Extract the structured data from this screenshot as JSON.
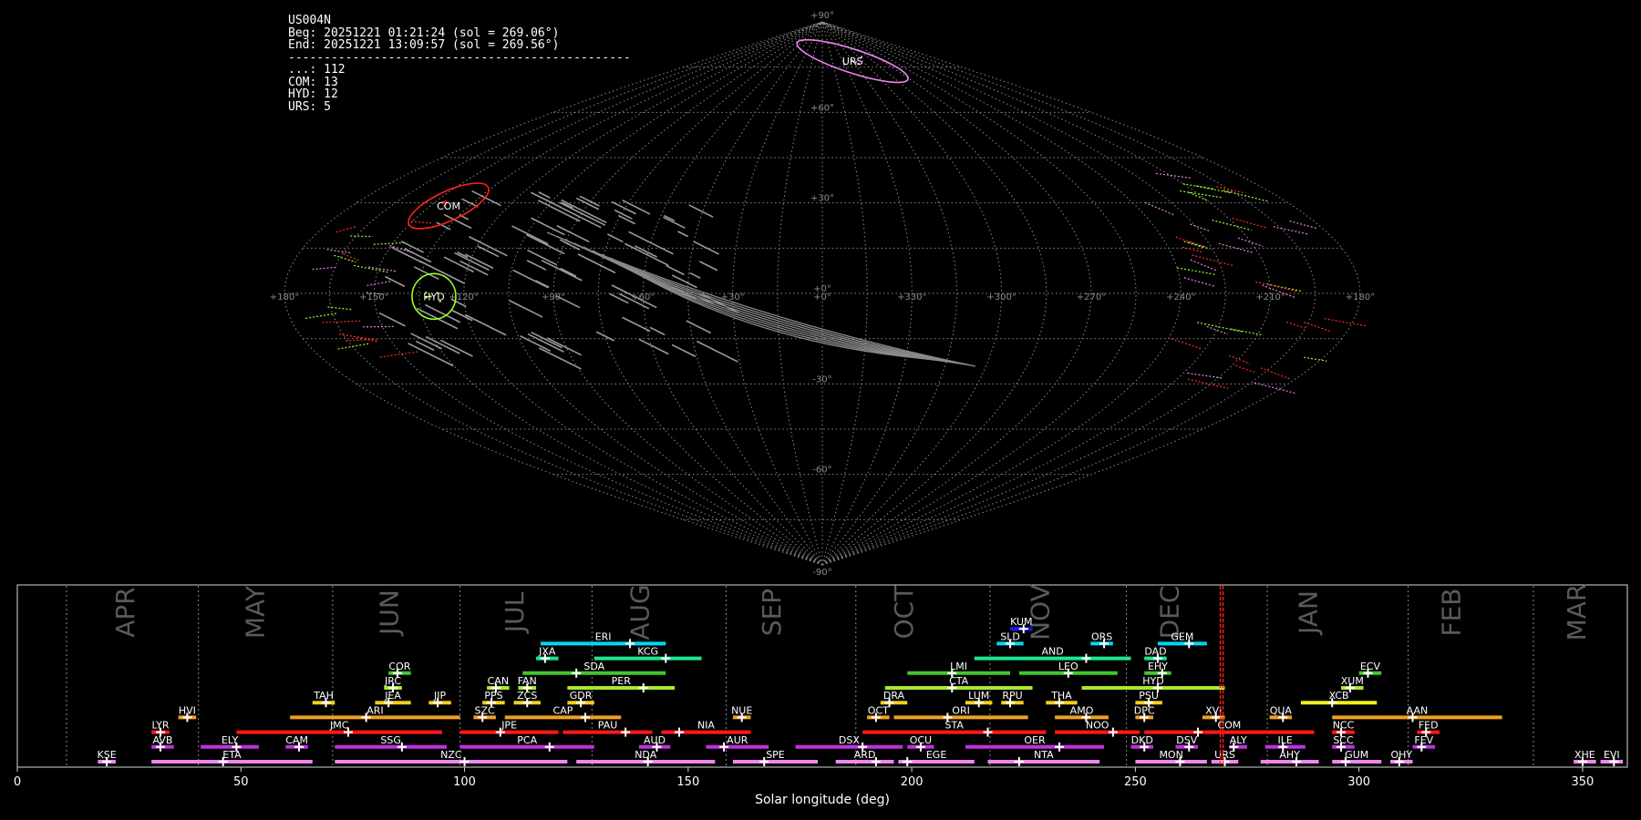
{
  "info": {
    "lines": [
      "US004N",
      "Beg: 20251221 01:21:24 (sol = 269.06°)",
      "End: 20251221 13:09:57 (sol = 269.56°)",
      "------------------------------------------------",
      "...: 112",
      "COM: 13",
      "HYD: 12",
      "URS: 5"
    ]
  },
  "sky_map": {
    "projection": "sinusoidal",
    "lat_ticks": [
      "+90°",
      "+60°",
      "+30°",
      "+0°",
      "-30°",
      "-60°",
      "-90°"
    ],
    "lon_ticks": [
      "+180°",
      "+150°",
      "+120°",
      "+90°",
      "+60°",
      "+30°",
      "+0°",
      "+330°",
      "+300°",
      "+270°",
      "+240°",
      "+210°",
      "+180°"
    ],
    "lon_tick_pos": [
      180,
      150,
      120,
      90,
      60,
      30,
      0,
      -30,
      -60,
      -90,
      -120,
      -150,
      -180
    ],
    "radiants": [
      {
        "code": "URS",
        "lon": -45,
        "lat": 77,
        "color": "#ee82ee",
        "w": 64,
        "h": 13,
        "rot": 18
      },
      {
        "code": "COM",
        "lon": 143,
        "lat": 29,
        "color": "#ff2020",
        "w": 48,
        "h": 16,
        "rot": -25
      },
      {
        "code": "HYD",
        "lon": 130,
        "lat": -1,
        "color": "#9aff2a",
        "w": 24,
        "h": 25,
        "rot": 0
      }
    ]
  },
  "chart_data": {
    "type": "timeline",
    "xlabel": "Solar longitude (deg)",
    "xlim": [
      0,
      360
    ],
    "xticks": [
      0,
      50,
      100,
      150,
      200,
      250,
      300,
      350
    ],
    "month_labels": [
      {
        "label": "APR",
        "x": 24.5
      },
      {
        "label": "MAY",
        "x": 53.5
      },
      {
        "label": "JUN",
        "x": 83.5
      },
      {
        "label": "JUL",
        "x": 111.5
      },
      {
        "label": "AUG",
        "x": 139.5
      },
      {
        "label": "SEP",
        "x": 169
      },
      {
        "label": "OCT",
        "x": 198.5
      },
      {
        "label": "NOV",
        "x": 229
      },
      {
        "label": "DEC",
        "x": 258
      },
      {
        "label": "JAN",
        "x": 289
      },
      {
        "label": "FEB",
        "x": 321
      },
      {
        "label": "MAR",
        "x": 349
      }
    ],
    "month_boundaries": [
      11,
      40.5,
      70.5,
      99,
      128.5,
      158.5,
      187.5,
      217.5,
      248,
      279.5,
      311,
      339
    ],
    "current_sol": 269.3,
    "showers": [
      {
        "code": "KUM",
        "start": 222,
        "end": 227,
        "peak": 225,
        "row": 10,
        "color": "#1818ff"
      },
      {
        "code": "ERI",
        "start": 117,
        "end": 145,
        "peak": 137,
        "row": 9,
        "color": "#00d8f0"
      },
      {
        "code": "SLD",
        "start": 219,
        "end": 225,
        "peak": 222,
        "row": 9,
        "color": "#00d8f0"
      },
      {
        "code": "ORS",
        "start": 240,
        "end": 245,
        "peak": 243,
        "row": 9,
        "color": "#00d8f0"
      },
      {
        "code": "GEM",
        "start": 255,
        "end": 266,
        "peak": 262,
        "row": 9,
        "color": "#00d8f0"
      },
      {
        "code": "JXA",
        "start": 116,
        "end": 121,
        "peak": 118,
        "row": 8,
        "color": "#18e890"
      },
      {
        "code": "KCG",
        "start": 129,
        "end": 153,
        "peak": 145,
        "row": 8,
        "color": "#18e890"
      },
      {
        "code": "AND",
        "start": 214,
        "end": 249,
        "peak": 239,
        "row": 8,
        "color": "#18e890"
      },
      {
        "code": "DAD",
        "start": 252,
        "end": 257,
        "peak": 255,
        "row": 8,
        "color": "#18e890"
      },
      {
        "code": "COR",
        "start": 83,
        "end": 88,
        "peak": 85,
        "row": 7,
        "color": "#40c830"
      },
      {
        "code": "SDA",
        "start": 113,
        "end": 145,
        "peak": 125,
        "row": 7,
        "color": "#40c830"
      },
      {
        "code": "LMI",
        "start": 199,
        "end": 222,
        "peak": 209,
        "row": 7,
        "color": "#40c830"
      },
      {
        "code": "LEO",
        "start": 224,
        "end": 246,
        "peak": 235,
        "row": 7,
        "color": "#40c830"
      },
      {
        "code": "EHY",
        "start": 252,
        "end": 258,
        "peak": 256,
        "row": 7,
        "color": "#40c830"
      },
      {
        "code": "ECV",
        "start": 300,
        "end": 305,
        "peak": 302,
        "row": 7,
        "color": "#40c830"
      },
      {
        "code": "JRC",
        "start": 82,
        "end": 86,
        "peak": 84,
        "row": 6,
        "color": "#a8e830"
      },
      {
        "code": "CAN",
        "start": 105,
        "end": 110,
        "peak": 107,
        "row": 6,
        "color": "#a8e830"
      },
      {
        "code": "FAN",
        "start": 112,
        "end": 116,
        "peak": 114,
        "row": 6,
        "color": "#a8e830"
      },
      {
        "code": "PER",
        "start": 123,
        "end": 147,
        "peak": 140,
        "row": 6,
        "color": "#a8e830"
      },
      {
        "code": "CTA",
        "start": 194,
        "end": 227,
        "peak": 209,
        "row": 6,
        "color": "#a8e830"
      },
      {
        "code": "HYD",
        "start": 238,
        "end": 270,
        "peak": 255,
        "row": 6,
        "color": "#a8e830"
      },
      {
        "code": "XUM",
        "start": 296,
        "end": 301,
        "peak": 298,
        "row": 6,
        "color": "#a8e830"
      },
      {
        "code": "TAH",
        "start": 66,
        "end": 71,
        "peak": 69,
        "row": 5,
        "color": "#f0d020"
      },
      {
        "code": "JEA",
        "start": 80,
        "end": 88,
        "peak": 83,
        "row": 5,
        "color": "#f0d020"
      },
      {
        "code": "JIP",
        "start": 92,
        "end": 97,
        "peak": 94,
        "row": 5,
        "color": "#f0d020"
      },
      {
        "code": "PPS",
        "start": 104,
        "end": 109,
        "peak": 106,
        "row": 5,
        "color": "#f0d020"
      },
      {
        "code": "ZCS",
        "start": 111,
        "end": 117,
        "peak": 114,
        "row": 5,
        "color": "#f0d020"
      },
      {
        "code": "GDR",
        "start": 123,
        "end": 129,
        "peak": 126,
        "row": 5,
        "color": "#f0d020"
      },
      {
        "code": "DRA",
        "start": 193,
        "end": 199,
        "peak": 195,
        "row": 5,
        "color": "#f0d020"
      },
      {
        "code": "LUM",
        "start": 212,
        "end": 218,
        "peak": 215,
        "row": 5,
        "color": "#f0d020"
      },
      {
        "code": "RPU",
        "start": 220,
        "end": 225,
        "peak": 222,
        "row": 5,
        "color": "#f0d020"
      },
      {
        "code": "THA",
        "start": 230,
        "end": 237,
        "peak": 233,
        "row": 5,
        "color": "#f0d020"
      },
      {
        "code": "PSU",
        "start": 250,
        "end": 256,
        "peak": 253,
        "row": 5,
        "color": "#f0d020"
      },
      {
        "code": "XCB",
        "start": 287,
        "end": 304,
        "peak": 294,
        "row": 5,
        "color": "#f0f020"
      },
      {
        "code": "HVI",
        "start": 36,
        "end": 40,
        "peak": 38,
        "row": 4,
        "color": "#f0a020"
      },
      {
        "code": "ARI",
        "start": 61,
        "end": 99,
        "peak": 78,
        "row": 4,
        "color": "#f0a020"
      },
      {
        "code": "SZC",
        "start": 102,
        "end": 107,
        "peak": 104,
        "row": 4,
        "color": "#f0a020"
      },
      {
        "code": "CAP",
        "start": 109,
        "end": 135,
        "peak": 127,
        "row": 4,
        "color": "#f0a020"
      },
      {
        "code": "NUE",
        "start": 160,
        "end": 164,
        "peak": 162,
        "row": 4,
        "color": "#f0a020"
      },
      {
        "code": "OCT",
        "start": 190,
        "end": 195,
        "peak": 192,
        "row": 4,
        "color": "#f0a020"
      },
      {
        "code": "ORI",
        "start": 196,
        "end": 226,
        "peak": 208,
        "row": 4,
        "color": "#f0a020"
      },
      {
        "code": "AMO",
        "start": 232,
        "end": 244,
        "peak": 239,
        "row": 4,
        "color": "#f0a020"
      },
      {
        "code": "DPC",
        "start": 250,
        "end": 254,
        "peak": 252,
        "row": 4,
        "color": "#f0a020"
      },
      {
        "code": "XVI",
        "start": 265,
        "end": 270,
        "peak": 268,
        "row": 4,
        "color": "#f0a020"
      },
      {
        "code": "QUA",
        "start": 280,
        "end": 285,
        "peak": 283,
        "row": 4,
        "color": "#f0a020"
      },
      {
        "code": "AAN",
        "start": 294,
        "end": 332,
        "peak": 312,
        "row": 4,
        "color": "#f0a020"
      },
      {
        "code": "LYR",
        "start": 30,
        "end": 34,
        "peak": 32,
        "row": 3,
        "color": "#ff1818"
      },
      {
        "code": "JMC",
        "start": 49,
        "end": 95,
        "peak": 74,
        "row": 3,
        "color": "#ff1818"
      },
      {
        "code": "JPE",
        "start": 99,
        "end": 121,
        "peak": 108,
        "row": 3,
        "color": "#ff1818"
      },
      {
        "code": "PAU",
        "start": 122,
        "end": 142,
        "peak": 136,
        "row": 3,
        "color": "#ff1818"
      },
      {
        "code": "NIA",
        "start": 144,
        "end": 164,
        "peak": 148,
        "row": 3,
        "color": "#ff1818"
      },
      {
        "code": "STA",
        "start": 189,
        "end": 230,
        "peak": 217,
        "row": 3,
        "color": "#ff1818"
      },
      {
        "code": "NOO",
        "start": 232,
        "end": 251,
        "peak": 245,
        "row": 3,
        "color": "#ff1818"
      },
      {
        "code": "COM",
        "start": 252,
        "end": 290,
        "peak": 264,
        "row": 3,
        "color": "#ff1818"
      },
      {
        "code": "NCC",
        "start": 294,
        "end": 299,
        "peak": 296,
        "row": 3,
        "color": "#ff1818"
      },
      {
        "code": "FED",
        "start": 313,
        "end": 318,
        "peak": 315,
        "row": 3,
        "color": "#ff1818"
      },
      {
        "code": "AVB",
        "start": 30,
        "end": 35,
        "peak": 32,
        "row": 2,
        "color": "#c030e0"
      },
      {
        "code": "ELY",
        "start": 41,
        "end": 54,
        "peak": 49,
        "row": 2,
        "color": "#c030e0"
      },
      {
        "code": "CAM",
        "start": 60,
        "end": 65,
        "peak": 63,
        "row": 2,
        "color": "#c030e0"
      },
      {
        "code": "SSG",
        "start": 71,
        "end": 96,
        "peak": 86,
        "row": 2,
        "color": "#c030e0"
      },
      {
        "code": "PCA",
        "start": 99,
        "end": 129,
        "peak": 119,
        "row": 2,
        "color": "#c030e0"
      },
      {
        "code": "AUD",
        "start": 139,
        "end": 146,
        "peak": 143,
        "row": 2,
        "color": "#c030e0"
      },
      {
        "code": "AUR",
        "start": 154,
        "end": 168,
        "peak": 158,
        "row": 2,
        "color": "#c030e0"
      },
      {
        "code": "DSX",
        "start": 174,
        "end": 198,
        "peak": 189,
        "row": 2,
        "color": "#c030e0"
      },
      {
        "code": "OCU",
        "start": 199,
        "end": 205,
        "peak": 202,
        "row": 2,
        "color": "#c030e0"
      },
      {
        "code": "OER",
        "start": 212,
        "end": 243,
        "peak": 233,
        "row": 2,
        "color": "#c030e0"
      },
      {
        "code": "DKD",
        "start": 249,
        "end": 254,
        "peak": 252,
        "row": 2,
        "color": "#c030e0"
      },
      {
        "code": "DSV",
        "start": 259,
        "end": 264,
        "peak": 262,
        "row": 2,
        "color": "#c030e0"
      },
      {
        "code": "ALY",
        "start": 271,
        "end": 275,
        "peak": 272,
        "row": 2,
        "color": "#c030e0"
      },
      {
        "code": "ILE",
        "start": 279,
        "end": 288,
        "peak": 283,
        "row": 2,
        "color": "#c030e0"
      },
      {
        "code": "SCC",
        "start": 294,
        "end": 299,
        "peak": 296,
        "row": 2,
        "color": "#c030e0"
      },
      {
        "code": "FEV",
        "start": 312,
        "end": 317,
        "peak": 314,
        "row": 2,
        "color": "#c030e0"
      },
      {
        "code": "KSE",
        "start": 18,
        "end": 22,
        "peak": 20,
        "row": 1,
        "color": "#ee88ee"
      },
      {
        "code": "ETA",
        "start": 30,
        "end": 66,
        "peak": 46,
        "row": 1,
        "color": "#ee88ee"
      },
      {
        "code": "NZC",
        "start": 71,
        "end": 123,
        "peak": 100,
        "row": 1,
        "color": "#ee88ee"
      },
      {
        "code": "NDA",
        "start": 125,
        "end": 156,
        "peak": 141,
        "row": 1,
        "color": "#ee88ee"
      },
      {
        "code": "SPE",
        "start": 160,
        "end": 179,
        "peak": 167,
        "row": 1,
        "color": "#ee88ee"
      },
      {
        "code": "ARD",
        "start": 183,
        "end": 196,
        "peak": 192,
        "row": 1,
        "color": "#ee88ee"
      },
      {
        "code": "EGE",
        "start": 197,
        "end": 214,
        "peak": 199,
        "row": 1,
        "color": "#ee88ee"
      },
      {
        "code": "NTA",
        "start": 217,
        "end": 242,
        "peak": 224,
        "row": 1,
        "color": "#ee88ee"
      },
      {
        "code": "MON",
        "start": 250,
        "end": 266,
        "peak": 260,
        "row": 1,
        "color": "#ee88ee"
      },
      {
        "code": "URS",
        "start": 267,
        "end": 273,
        "peak": 270,
        "row": 1,
        "color": "#ee88ee"
      },
      {
        "code": "AHY",
        "start": 278,
        "end": 291,
        "peak": 286,
        "row": 1,
        "color": "#ee88ee"
      },
      {
        "code": "GUM",
        "start": 294,
        "end": 305,
        "peak": 297,
        "row": 1,
        "color": "#ee88ee"
      },
      {
        "code": "OHY",
        "start": 307,
        "end": 312,
        "peak": 309,
        "row": 1,
        "color": "#ee88ee"
      },
      {
        "code": "XHE",
        "start": 348,
        "end": 353,
        "peak": 350,
        "row": 1,
        "color": "#ee88ee"
      },
      {
        "code": "EVI",
        "start": 354,
        "end": 359,
        "peak": 357,
        "row": 1,
        "color": "#ee88ee"
      }
    ]
  }
}
